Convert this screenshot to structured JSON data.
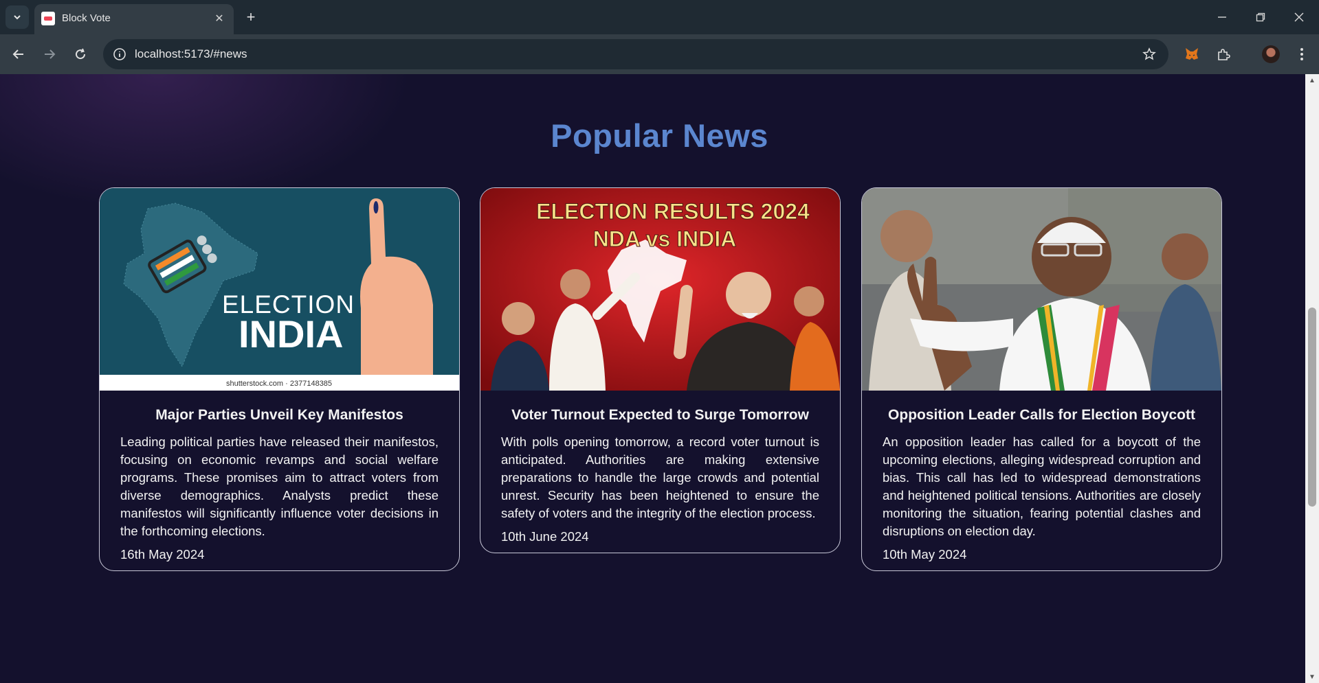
{
  "browser": {
    "tab_title": "Block Vote",
    "url": "localhost:5173/#news"
  },
  "page": {
    "section_title": "Popular News",
    "cards": [
      {
        "title": "Major Parties Unveil Key Manifestos",
        "description": "Leading political parties have released their manifestos, focusing on economic revamps and social welfare programs. These promises aim to attract voters from diverse demographics. Analysts predict these manifestos will significantly influence voter decisions in the forthcoming elections.",
        "date": "16th May 2024",
        "image": {
          "line1": "ELECTION",
          "line2": "INDIA",
          "credit": "shutterstock.com · 2377148385"
        }
      },
      {
        "title": "Voter Turnout Expected to Surge Tomorrow",
        "description": "With polls opening tomorrow, a record voter turnout is anticipated. Authorities are making extensive preparations to handle the large crowds and potential unrest. Security has been heightened to ensure the safety of voters and the integrity of the election process.",
        "date": "10th June 2024",
        "image": {
          "headline1": "ELECTION RESULTS 2024",
          "headline2": "NDA vs INDIA"
        }
      },
      {
        "title": "Opposition Leader Calls for Election Boycott",
        "description": "An opposition leader has called for a boycott of the upcoming elections, alleging widespread corruption and bias. This call has led to widespread demonstrations and heightened political tensions. Authorities are closely monitoring the situation, fearing potential clashes and disruptions on election day.",
        "date": "10th May 2024",
        "image": {}
      }
    ]
  }
}
